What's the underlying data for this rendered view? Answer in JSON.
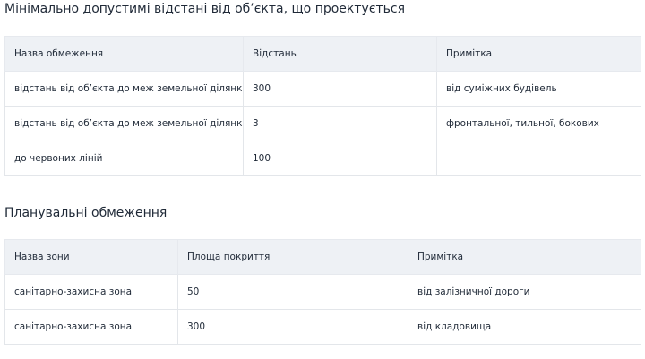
{
  "distances": {
    "title": "Мінімально допустимі відстані від об’єкта, що проектується",
    "headers": [
      "Назва обмеження",
      "Відстань",
      "Примітка"
    ],
    "rows": [
      [
        "відстань від об’єкта до меж земельної ділянки",
        "300",
        "від суміжних будівель"
      ],
      [
        "відстань від об’єкта до меж земельної ділянки",
        "3",
        "фронтальної, тильної, бокових"
      ],
      [
        "до червоних ліній",
        "100",
        ""
      ]
    ]
  },
  "planning": {
    "title": "Планувальні обмеження",
    "headers": [
      "Назва зони",
      "Площа покриття",
      "Примітка"
    ],
    "rows": [
      [
        "санітарно-захисна зона",
        "50",
        "від залізничної дороги"
      ],
      [
        "санітарно-захисна зона",
        "300",
        "від кладовища"
      ]
    ]
  }
}
